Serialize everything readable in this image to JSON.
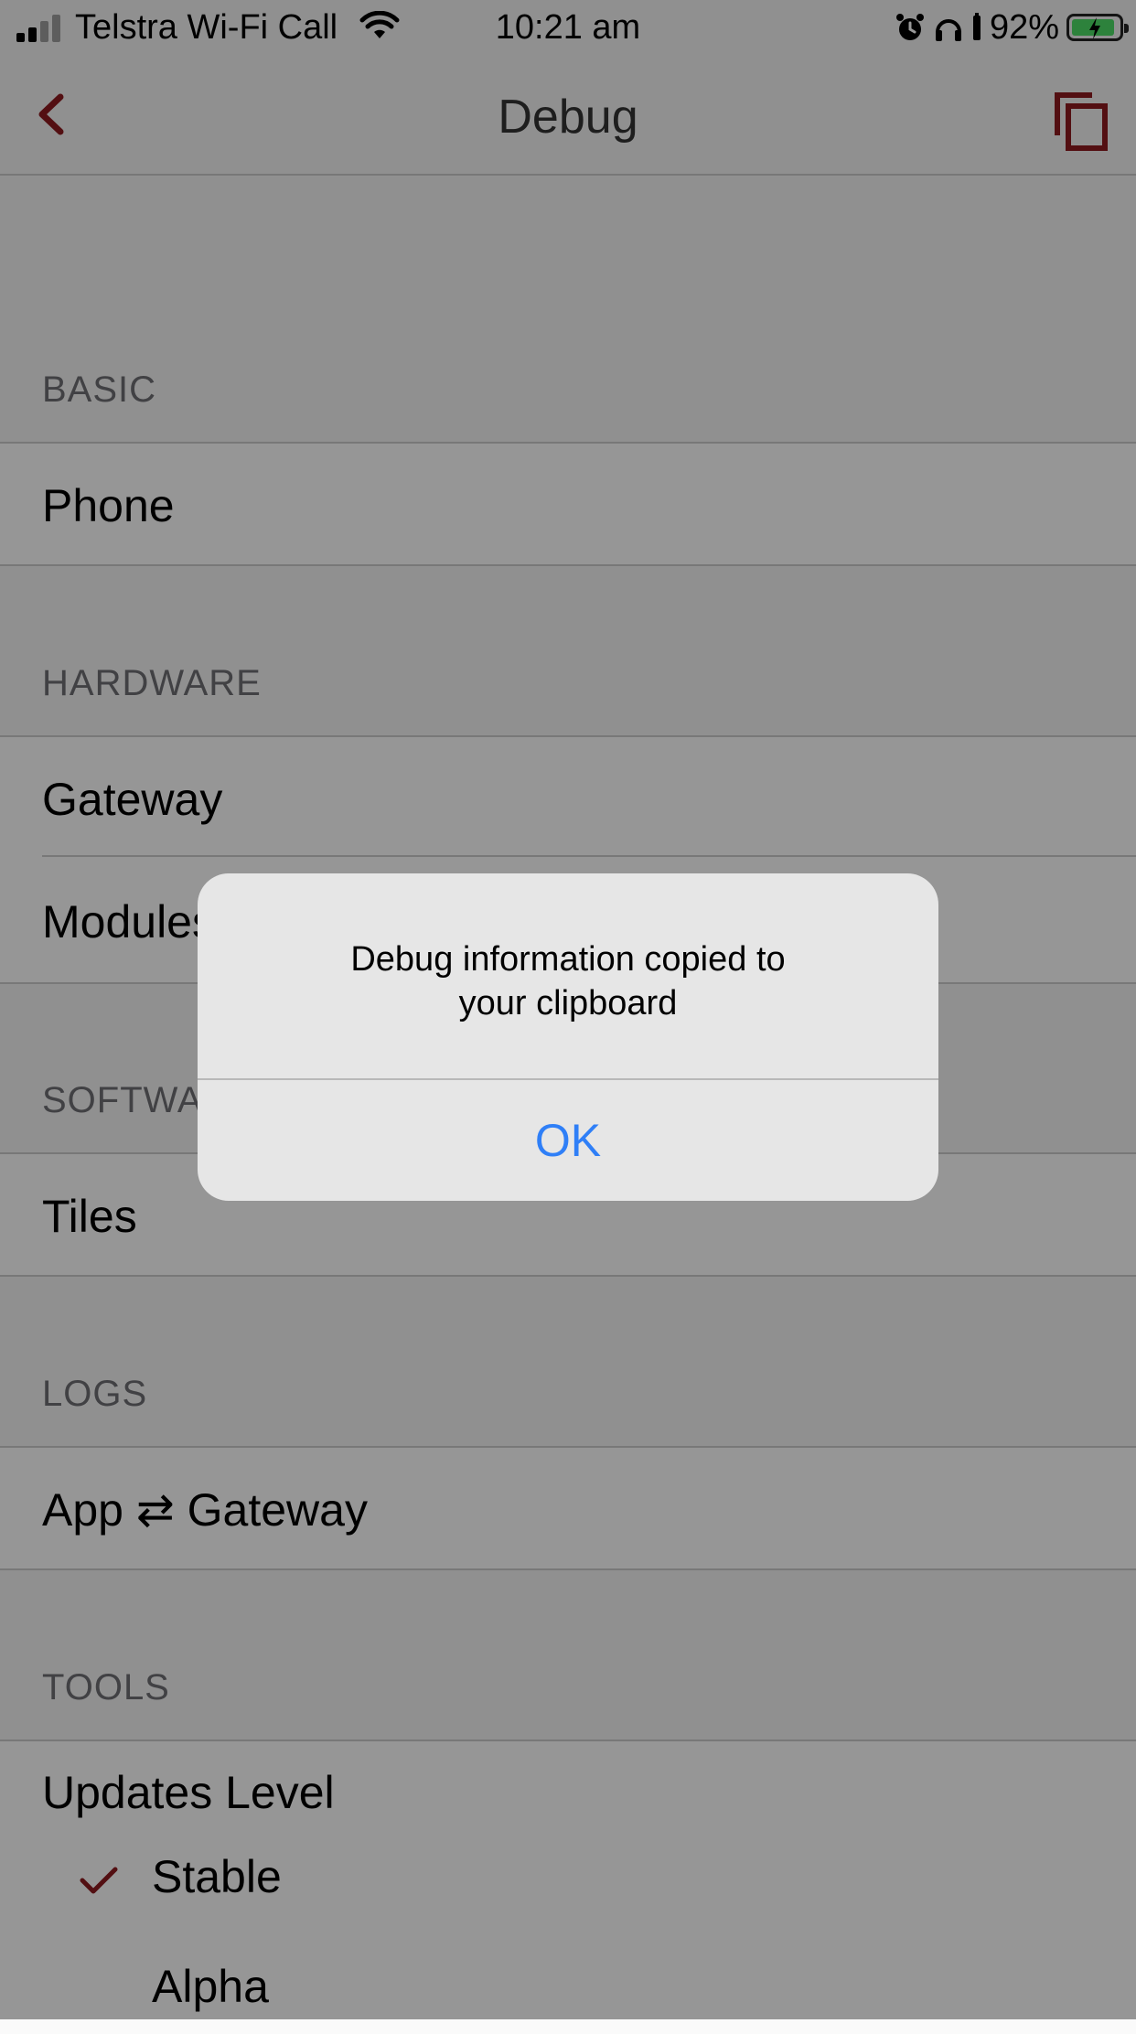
{
  "status_bar": {
    "carrier": "Telstra Wi-Fi Call",
    "time": "10:21 am",
    "battery_percent": "92%",
    "battery_level": 0.92,
    "icons": [
      "signal-icon",
      "wifi-icon",
      "alarm-icon",
      "headphones-icon",
      "battery-icon",
      "charging-bolt-icon"
    ]
  },
  "nav": {
    "title": "Debug",
    "back_icon": "chevron-left-icon",
    "copy_icon": "copy-icon",
    "accent_color": "#8b1a1f"
  },
  "sections": {
    "basic": {
      "header": "BASIC",
      "items": [
        "Phone"
      ]
    },
    "hardware": {
      "header": "HARDWARE",
      "items": [
        "Gateway",
        "Modules"
      ]
    },
    "software": {
      "header": "SOFTWARE",
      "items": [
        "Tiles"
      ]
    },
    "logs": {
      "header": "LOGS",
      "items": [
        "App ⇄ Gateway"
      ]
    },
    "tools": {
      "header": "TOOLS",
      "updates_level_label": "Updates Level",
      "options": [
        {
          "label": "Stable",
          "selected": true
        },
        {
          "label": "Alpha",
          "selected": false
        }
      ]
    }
  },
  "alert": {
    "message_line1": "Debug information copied to",
    "message_line2": "your clipboard",
    "ok_label": "OK",
    "button_color": "#2f7ff7"
  }
}
